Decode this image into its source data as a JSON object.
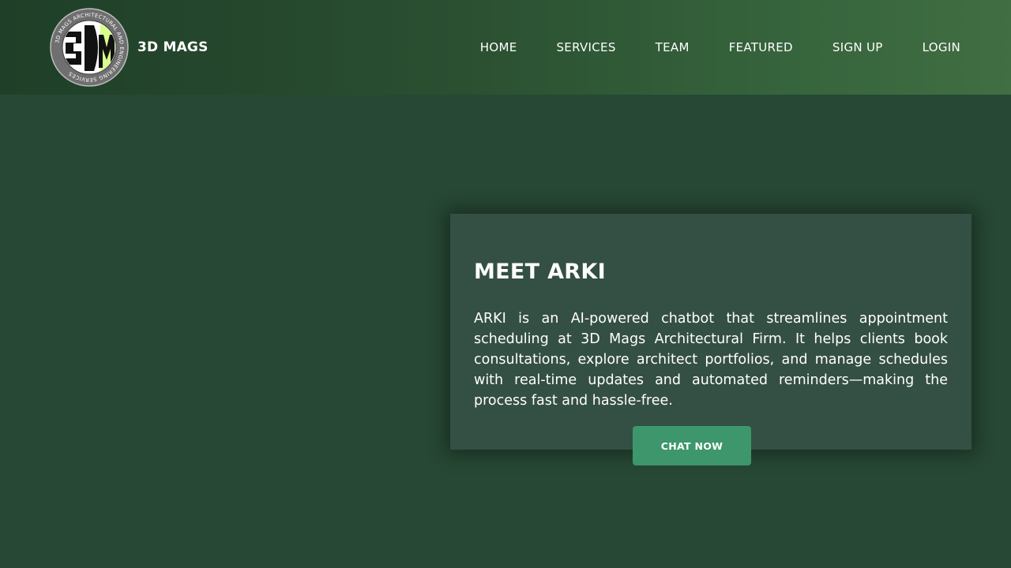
{
  "header": {
    "brand_name": "3D MAGS",
    "logo": {
      "monogram": "3DM",
      "ring_text": "3D MAGS ARCHITECTURAL AND ENGINEERING SERVICES"
    },
    "nav": [
      {
        "label": "HOME"
      },
      {
        "label": "SERVICES"
      },
      {
        "label": "TEAM"
      },
      {
        "label": "FEATURED"
      },
      {
        "label": "SIGN UP"
      },
      {
        "label": "LOGIN"
      }
    ]
  },
  "hero": {
    "title": "MEET ARKI",
    "body": "ARKI is an AI-powered chatbot that streamlines appointment scheduling at 3D Mags Architectural Firm. It helps clients book consultations, explore architect portfolios, and manage schedules with real-time updates and automated reminders—making the process fast and hassle-free.",
    "cta_label": "CHAT NOW"
  },
  "colors": {
    "page_background": "#274834",
    "header_gradient_start": "#1f3f28",
    "header_gradient_end": "#416e42",
    "card_background": "#344f44",
    "button_background": "#3e966c",
    "logo_accent": "#d9ff8a",
    "logo_ring": "#6f6f6f"
  }
}
